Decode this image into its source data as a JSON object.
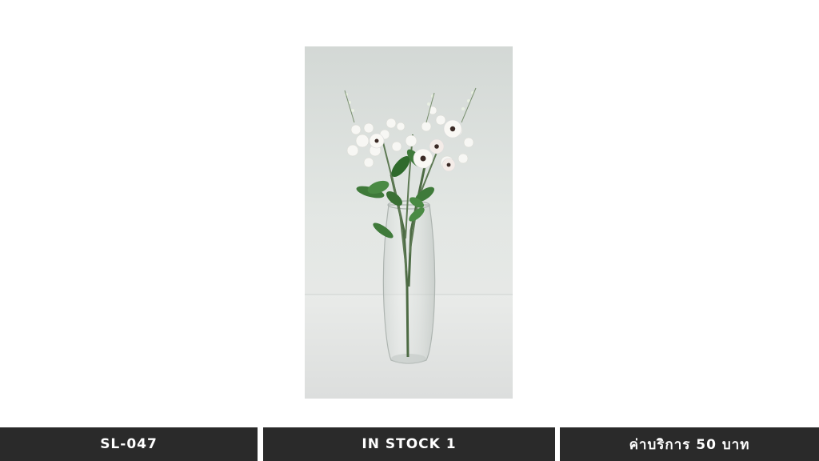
{
  "product": {
    "code": "SL-047",
    "stock": "IN STOCK 1",
    "price": "ค่าบริการ 50 บาท"
  },
  "colors": {
    "footer_bg": "#2a2a2a",
    "footer_text": "#ffffff",
    "photo_bg": "#dfe3e0"
  }
}
